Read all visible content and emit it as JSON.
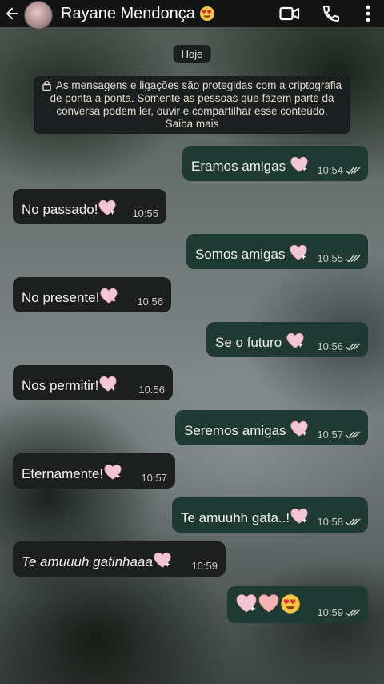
{
  "header": {
    "contact_name": "Rayane Mendonça",
    "status_emoji": "heart-eyes-face",
    "icons": [
      "back-arrow-icon",
      "video-call-icon",
      "phone-icon",
      "more-icon"
    ]
  },
  "date_chip": "Hoje",
  "encryption_notice": "As mensagens e ligações são protegidas com a criptografia de ponta a ponta. Somente as pessoas que fazem parte da conversa podem ler, ouvir e compartilhar esse conteúdo. Saiba mais",
  "messages": [
    {
      "direction": "out",
      "text": "Eramos amigas",
      "time": "10:54",
      "status": "read"
    },
    {
      "direction": "in",
      "text": "No passado!",
      "time": "10:55"
    },
    {
      "direction": "out",
      "text": "Somos amigas",
      "time": "10:55",
      "status": "read"
    },
    {
      "direction": "in",
      "text": "No presente!",
      "time": "10:56"
    },
    {
      "direction": "out",
      "text": "Se o futuro",
      "time": "10:56",
      "status": "read"
    },
    {
      "direction": "in",
      "text": "Nos permitir!",
      "time": "10:56"
    },
    {
      "direction": "out",
      "text": "Seremos amigas",
      "time": "10:57",
      "status": "read"
    },
    {
      "direction": "in",
      "text": "Eternamente!",
      "time": "10:57"
    },
    {
      "direction": "out",
      "text": "Te amuuhh gata..!",
      "time": "10:58",
      "status": "read"
    },
    {
      "direction": "in",
      "text": "Te amuuuh gatinhaaa",
      "time": "10:59",
      "style": "italic"
    },
    {
      "direction": "out",
      "text": "",
      "emojis": [
        "sparkling-heart",
        "pink-heart",
        "heart-eyes-face"
      ],
      "time": "10:59",
      "status": "read"
    }
  ],
  "colors": {
    "header_bg": "#121212",
    "incoming_bubble": "#1d1f1f",
    "outgoing_bubble": "#1f3a32",
    "heart": "#f3c6d6"
  }
}
